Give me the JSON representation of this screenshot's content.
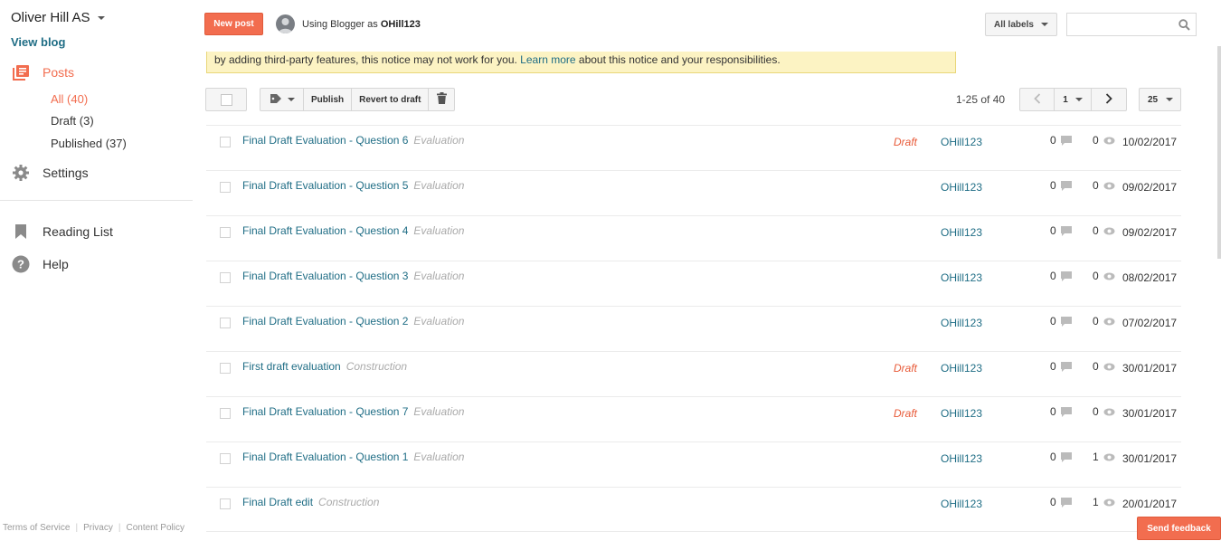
{
  "sidebar": {
    "blog_title": "Oliver Hill AS",
    "view_blog": "View blog",
    "posts_label": "Posts",
    "sub": {
      "all": "All (40)",
      "draft": "Draft (3)",
      "published": "Published (37)"
    },
    "settings": "Settings",
    "reading_list": "Reading List",
    "help": "Help",
    "footer": {
      "terms": "Terms of Service",
      "privacy": "Privacy",
      "content_policy": "Content Policy"
    }
  },
  "header": {
    "new_post": "New post",
    "using_prefix": "Using Blogger as",
    "username": "OHill123",
    "labels_button": "All labels",
    "search_placeholder": ""
  },
  "notice": {
    "text_before": "by adding third-party features, this notice may not work for you.",
    "link": "Learn more",
    "text_after": "about this notice and your responsibilities."
  },
  "toolbar": {
    "publish": "Publish",
    "revert": "Revert to draft",
    "range": "1-25 of 40",
    "page": "1",
    "per_page": "25"
  },
  "posts": [
    {
      "title": "Final Draft Evaluation - Question 6",
      "label": "Evaluation",
      "status": "Draft",
      "author": "OHill123",
      "comments": "0",
      "views": "0",
      "date": "10/02/2017"
    },
    {
      "title": "Final Draft Evaluation - Question 5",
      "label": "Evaluation",
      "status": "",
      "author": "OHill123",
      "comments": "0",
      "views": "0",
      "date": "09/02/2017"
    },
    {
      "title": "Final Draft Evaluation - Question 4",
      "label": "Evaluation",
      "status": "",
      "author": "OHill123",
      "comments": "0",
      "views": "0",
      "date": "09/02/2017"
    },
    {
      "title": "Final Draft Evaluation - Question 3",
      "label": "Evaluation",
      "status": "",
      "author": "OHill123",
      "comments": "0",
      "views": "0",
      "date": "08/02/2017"
    },
    {
      "title": "Final Draft Evaluation - Question 2",
      "label": "Evaluation",
      "status": "",
      "author": "OHill123",
      "comments": "0",
      "views": "0",
      "date": "07/02/2017"
    },
    {
      "title": "First draft evaluation",
      "label": "Construction",
      "status": "Draft",
      "author": "OHill123",
      "comments": "0",
      "views": "0",
      "date": "30/01/2017"
    },
    {
      "title": "Final Draft Evaluation - Question 7",
      "label": "Evaluation",
      "status": "Draft",
      "author": "OHill123",
      "comments": "0",
      "views": "0",
      "date": "30/01/2017"
    },
    {
      "title": "Final Draft Evaluation - Question 1",
      "label": "Evaluation",
      "status": "",
      "author": "OHill123",
      "comments": "0",
      "views": "1",
      "date": "30/01/2017"
    },
    {
      "title": "Final Draft edit",
      "label": "Construction",
      "status": "",
      "author": "OHill123",
      "comments": "0",
      "views": "1",
      "date": "20/01/2017"
    }
  ],
  "feedback": "Send feedback",
  "colors": {
    "accent": "#f26d4f",
    "link": "#1f6d85",
    "notice_bg": "#fcf3c3",
    "draft": "#e85a38"
  },
  "icons": [
    "posts-icon",
    "gear-icon",
    "bookmark-icon",
    "help-icon",
    "avatar",
    "search-icon",
    "label-icon",
    "trash-icon",
    "chevron-left-icon",
    "chevron-right-icon",
    "comment-icon",
    "eye-icon"
  ]
}
